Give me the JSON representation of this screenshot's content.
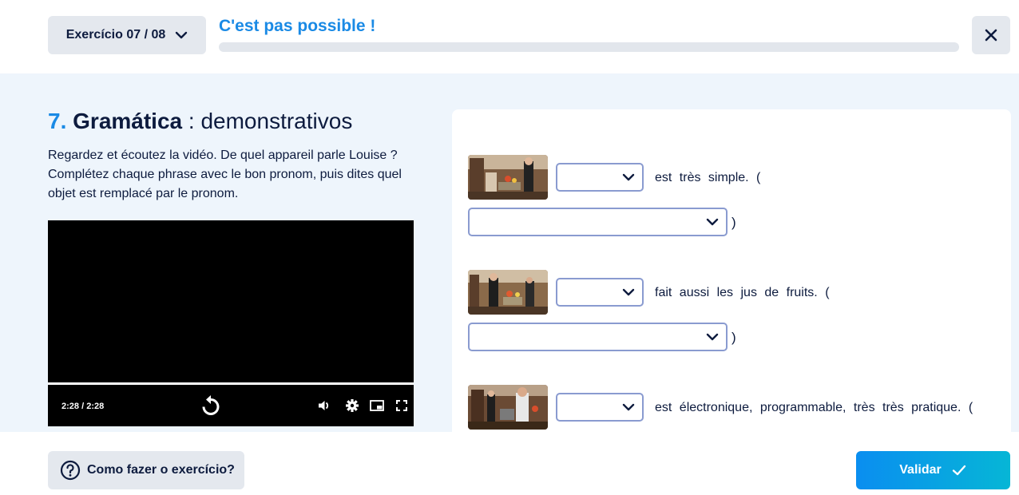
{
  "header": {
    "exercise_selector": "Exercício 07 / 08",
    "title": "C'est pas possible !",
    "progress_fraction": 0
  },
  "exercise": {
    "number": "7.",
    "type": "Gramática",
    "separator": " : ",
    "topic": "demonstrativos",
    "instructions": "Regardez et écoutez la vidéo. De quel appareil parle Louise ? Complétez chaque phrase avec le bon pronom, puis dites quel objet est remplacé par le pronom."
  },
  "video": {
    "current_time": "2:28",
    "separator": "/",
    "duration": "2:28",
    "played_fraction": 1
  },
  "questions": [
    {
      "pronoun_value": "",
      "text": "est très simple. (",
      "object_value": "",
      "close_paren": ")"
    },
    {
      "pronoun_value": "",
      "text": "fait aussi les jus de fruits. (",
      "object_value": "",
      "close_paren": ")"
    },
    {
      "pronoun_value": "",
      "text": "est électronique, programmable, très très pratique. (",
      "object_value": "",
      "close_paren": ")"
    }
  ],
  "footer": {
    "help_label": "Como fazer o exercício?",
    "validate_label": "Validar"
  },
  "colors": {
    "accent": "#1a8ae5",
    "text": "#0d1b3e",
    "page_bg": "#eef5fc",
    "select_border": "#8a9bd0"
  }
}
